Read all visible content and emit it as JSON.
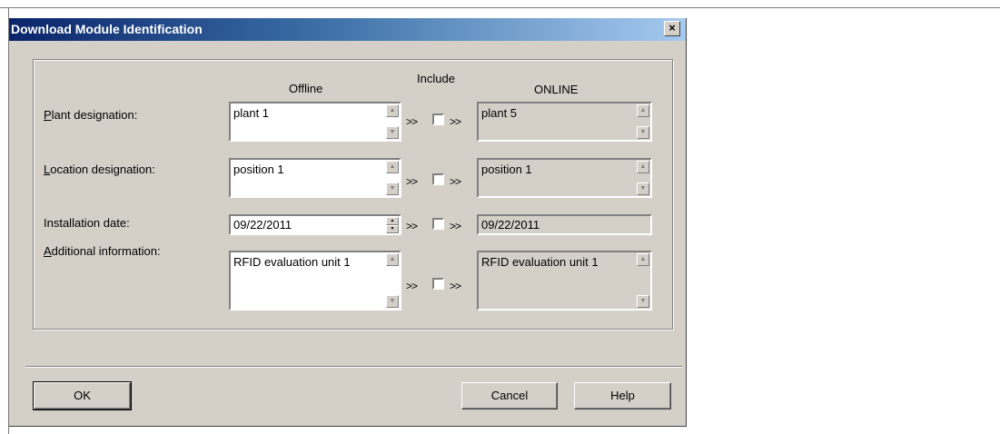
{
  "dialog": {
    "title": "Download Module Identification",
    "close_glyph": "×"
  },
  "columns": {
    "offline": "Offline",
    "include": "Include",
    "online": "ONLINE"
  },
  "rows": [
    {
      "label_first": "P",
      "label_rest": "lant designation:",
      "offline": "plant 1",
      "online": "plant 5"
    },
    {
      "label_first": "L",
      "label_rest": "ocation designation:",
      "offline": "position 1",
      "online": "position 1"
    },
    {
      "label_first": "",
      "label_rest": "Installation date:",
      "offline": "09/22/2011",
      "online": "09/22/2011"
    },
    {
      "label_first": "A",
      "label_rest": "dditional information:",
      "offline": "RFID evaluation unit 1",
      "online": "RFID evaluation unit 1"
    }
  ],
  "arrows": ">>",
  "buttons": {
    "ok": "OK",
    "cancel": "Cancel",
    "help": "Help"
  },
  "icons": [
    "close-icon",
    "scroll-up-icon",
    "scroll-down-icon",
    "spin-up-icon",
    "spin-down-icon"
  ]
}
